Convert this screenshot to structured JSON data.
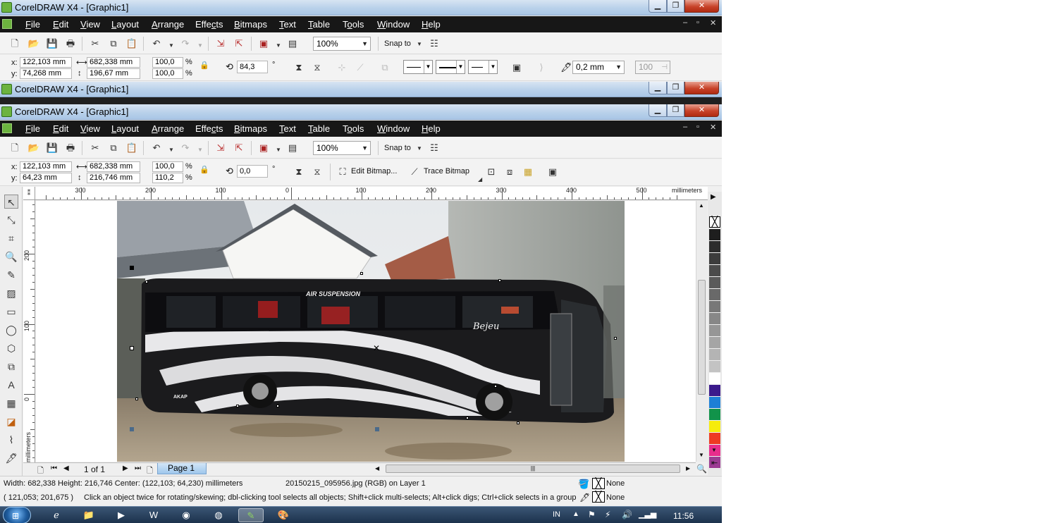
{
  "window": {
    "title": "CorelDRAW X4 - [Graphic1]",
    "min_glyph": "▁",
    "max_glyph": "❐",
    "close_glyph": "✕"
  },
  "menu": {
    "items": [
      "File",
      "Edit",
      "View",
      "Layout",
      "Arrange",
      "Effects",
      "Bitmaps",
      "Text",
      "Table",
      "Tools",
      "Window",
      "Help"
    ],
    "underline": [
      "F",
      "E",
      "V",
      "L",
      "A",
      "c",
      "B",
      "T",
      "T",
      "o",
      "W",
      "H"
    ],
    "doc_controls": [
      "–",
      "▫",
      "✕"
    ]
  },
  "standard_toolbar": {
    "zoom": "100%",
    "snap_to": "Snap to"
  },
  "property_bar_top": {
    "x_label": "x:",
    "x": "122,103 mm",
    "y_label": "y:",
    "y": "74,268 mm",
    "width": "682,338 mm",
    "height": "196,67 mm",
    "scale_w": "100,0",
    "scale_h": "100,0",
    "percent": "%",
    "rotation": "84,3",
    "degree": "°",
    "outline_width": "0,2 mm",
    "opacity": "100"
  },
  "property_bar_bitmap": {
    "x_label": "x:",
    "x": "122,103 mm",
    "y_label": "y:",
    "y": "64,23 mm",
    "width": "682,338 mm",
    "height": "216,746 mm",
    "scale_w": "100,0",
    "scale_h": "110,2",
    "percent": "%",
    "rotation": "0,0",
    "degree": "°",
    "edit_bitmap": "Edit Bitmap...",
    "trace_bitmap": "Trace Bitmap"
  },
  "rulers": {
    "unit": "millimeters",
    "h_labels": [
      "300",
      "200",
      "100",
      "0",
      "100",
      "200",
      "300",
      "400",
      "500"
    ],
    "v_labels": [
      "200",
      "100",
      "0"
    ]
  },
  "image": {
    "bus_text": [
      "AIR SUSPENSION",
      "Bejeu",
      "AKAP"
    ]
  },
  "page_nav": {
    "page_count": "1 of 1",
    "page_tab": "Page 1"
  },
  "palette": {
    "colors": [
      "#1e1e1e",
      "#2d2d2d",
      "#3c3c3c",
      "#4b4b4b",
      "#5a5a5a",
      "#696969",
      "#787878",
      "#878787",
      "#969696",
      "#a5a5a5",
      "#b4b4b4",
      "#c3c3c3",
      "#ffffff",
      "#3b1a8c",
      "#1d7fd6",
      "#11934a",
      "#f6ec0b",
      "#ee3a23",
      "#e72d8c",
      "#9b3b92"
    ]
  },
  "status": {
    "line1": "Width: 682,338  Height: 216,746  Center: (122,103; 64,230)  millimeters",
    "object_info": "20150215_095956.jpg (RGB) on Layer 1",
    "line2_coords": "( 121,053; 201,675 )",
    "line2_hint": "Click an object twice for rotating/skewing; dbl-clicking tool selects all objects; Shift+click multi-selects; Alt+click digs; Ctrl+click selects in a group",
    "fill": "None",
    "outline": "None"
  },
  "taskbar": {
    "lang": "IN",
    "time": "11:56"
  }
}
